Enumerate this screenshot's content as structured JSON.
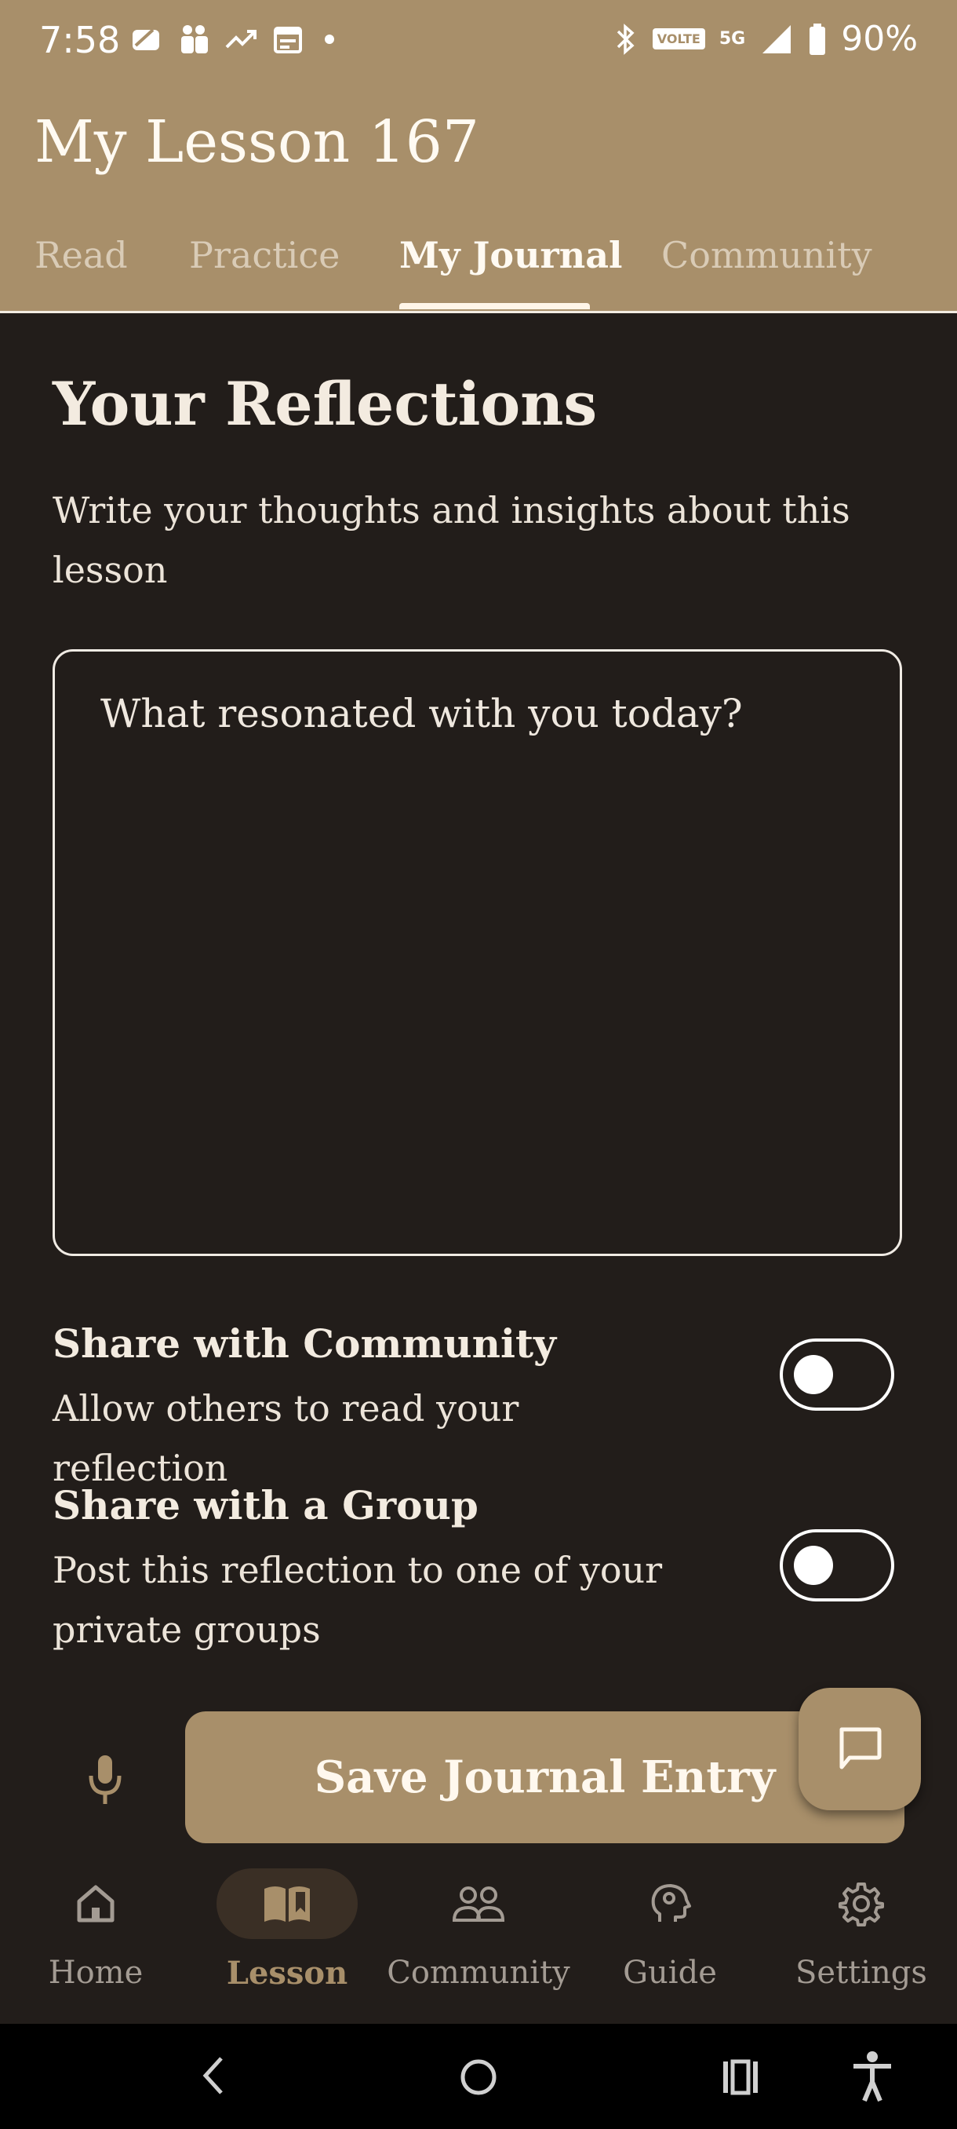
{
  "status_bar": {
    "time": "7:58",
    "battery": "90%",
    "network": "5G",
    "volte": "VOLTE"
  },
  "app_bar": {
    "title": "My Lesson 167",
    "tabs": [
      {
        "label": "Read",
        "active": false
      },
      {
        "label": "Practice",
        "active": false
      },
      {
        "label": "My Journal",
        "active": true
      },
      {
        "label": "Community",
        "active": false
      }
    ]
  },
  "journal": {
    "heading": "Your Reflections",
    "subtitle": "Write your thoughts and insights about this lesson",
    "placeholder": "What resonated with you today?",
    "value": ""
  },
  "settings": [
    {
      "title": "Share with Community",
      "desc": "Allow others to read your reflection",
      "enabled": false
    },
    {
      "title": "Share with a Group",
      "desc": "Post this reflection to one of your private groups",
      "enabled": false
    }
  ],
  "save_button": "Save Journal Entry",
  "bottom_nav": [
    {
      "label": "Home",
      "icon": "home-icon",
      "active": false
    },
    {
      "label": "Lesson",
      "icon": "book-icon",
      "active": true
    },
    {
      "label": "Community",
      "icon": "people-icon",
      "active": false
    },
    {
      "label": "Guide",
      "icon": "head-icon",
      "active": false
    },
    {
      "label": "Settings",
      "icon": "gear-icon",
      "active": false
    }
  ],
  "colors": {
    "accent": "#a88f6a",
    "background": "#221d1a"
  }
}
